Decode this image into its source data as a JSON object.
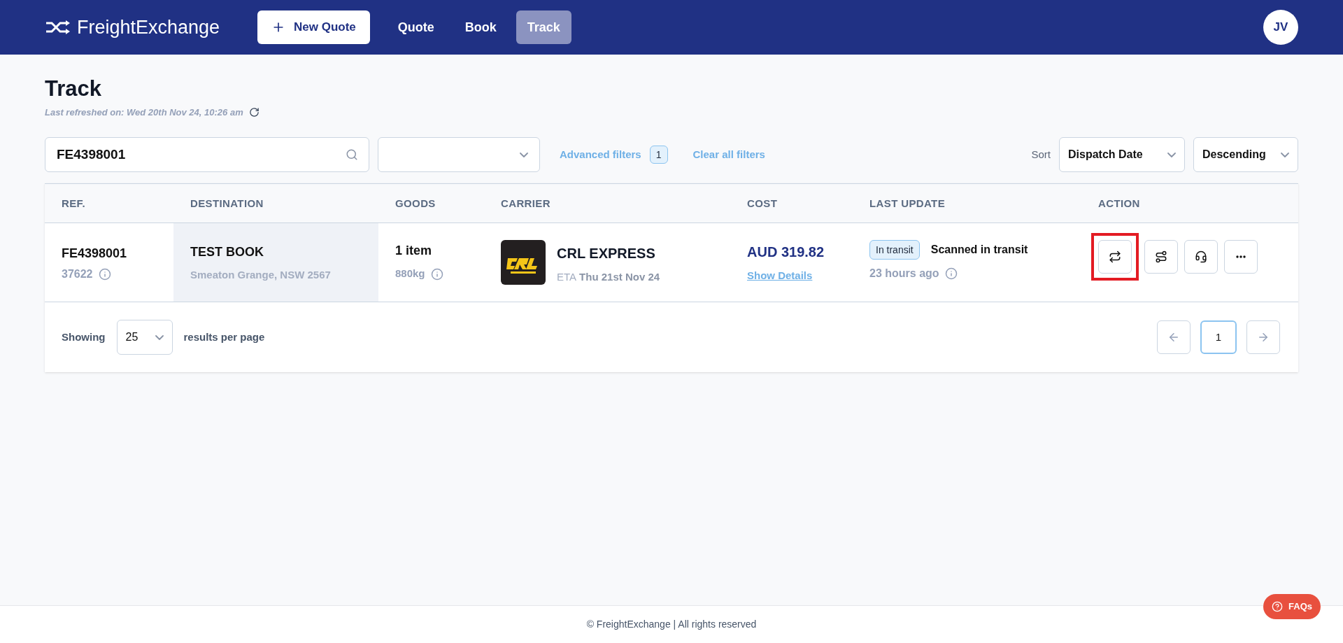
{
  "header": {
    "brand": "FreightExchange",
    "new_quote": "New Quote",
    "nav": [
      {
        "label": "Quote",
        "selected": false
      },
      {
        "label": "Book",
        "selected": false
      },
      {
        "label": "Track",
        "selected": true
      }
    ],
    "avatar": "JV"
  },
  "page": {
    "title": "Track",
    "refreshed": "Last refreshed on: Wed 20th Nov 24, 10:26 am"
  },
  "filters": {
    "search": {
      "value": "FE4398001"
    },
    "advanced_filters": "Advanced filters",
    "advanced_count": "1",
    "clear": "Clear all filters",
    "sort_label": "Sort",
    "sort_by": "Dispatch Date",
    "sort_order": "Descending"
  },
  "table": {
    "columns": [
      "REF.",
      "DESTINATION",
      "GOODS",
      "CARRIER",
      "COST",
      "LAST UPDATE",
      "ACTION"
    ],
    "rows": [
      {
        "ref": "FE4398001",
        "ref_sub": "37622",
        "destination": "TEST BOOK",
        "address": "Smeaton Grange, NSW 2567",
        "goods": "1 item",
        "weight": "880kg",
        "carrier": "CRL EXPRESS",
        "eta_label": "ETA",
        "eta": "Thu 21st Nov 24",
        "cost": "AUD 319.82",
        "cost_link": "Show Details",
        "status": "In transit",
        "update": "Scanned in transit",
        "update_time": "23 hours ago",
        "actions": [
          {
            "kind": "swap",
            "highlighted": true
          },
          {
            "kind": "route",
            "highlighted": false
          },
          {
            "kind": "support",
            "highlighted": false
          },
          {
            "kind": "more",
            "highlighted": false
          }
        ]
      }
    ]
  },
  "pagination": {
    "showing": "Showing",
    "per_page": "25",
    "per_page_label": "results per page",
    "pages": [
      {
        "label": "1",
        "selected": true
      }
    ]
  },
  "footer": {
    "text": "© FreightExchange | All rights reserved",
    "faqs": "FAQs"
  }
}
